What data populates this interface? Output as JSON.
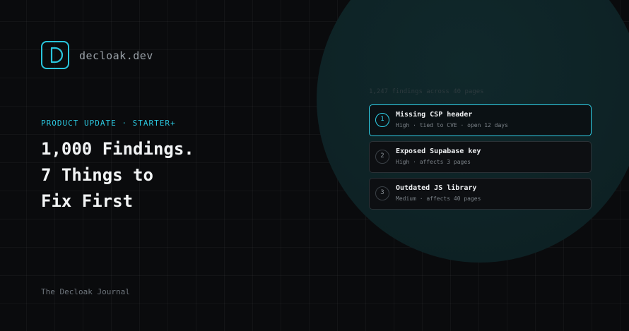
{
  "brand": {
    "name": "decloak.dev",
    "logo_letter": "D",
    "icon": "d-letter-logo-icon",
    "accent_color": "#29c5dd"
  },
  "article": {
    "eyebrow": "PRODUCT UPDATE · STARTER+",
    "headline_lines": [
      "1,000 Findings.",
      "7 Things to",
      "Fix First"
    ],
    "footer": "The Decloak Journal"
  },
  "findings_panel": {
    "caption": "1,247 findings across 40 pages",
    "items": [
      {
        "rank": "1",
        "title": "Missing CSP header",
        "meta": "High · tied to CVE · open 12 days",
        "highlighted": true
      },
      {
        "rank": "2",
        "title": "Exposed Supabase key",
        "meta": "High · affects 3 pages",
        "highlighted": false
      },
      {
        "rank": "3",
        "title": "Outdated JS library",
        "meta": "Medium · affects 40 pages",
        "highlighted": false
      }
    ]
  },
  "colors": {
    "background": "#0a0b0d",
    "circle": "#0e2326",
    "accent": "#2fd0e8",
    "card_border": "#2b3136"
  }
}
